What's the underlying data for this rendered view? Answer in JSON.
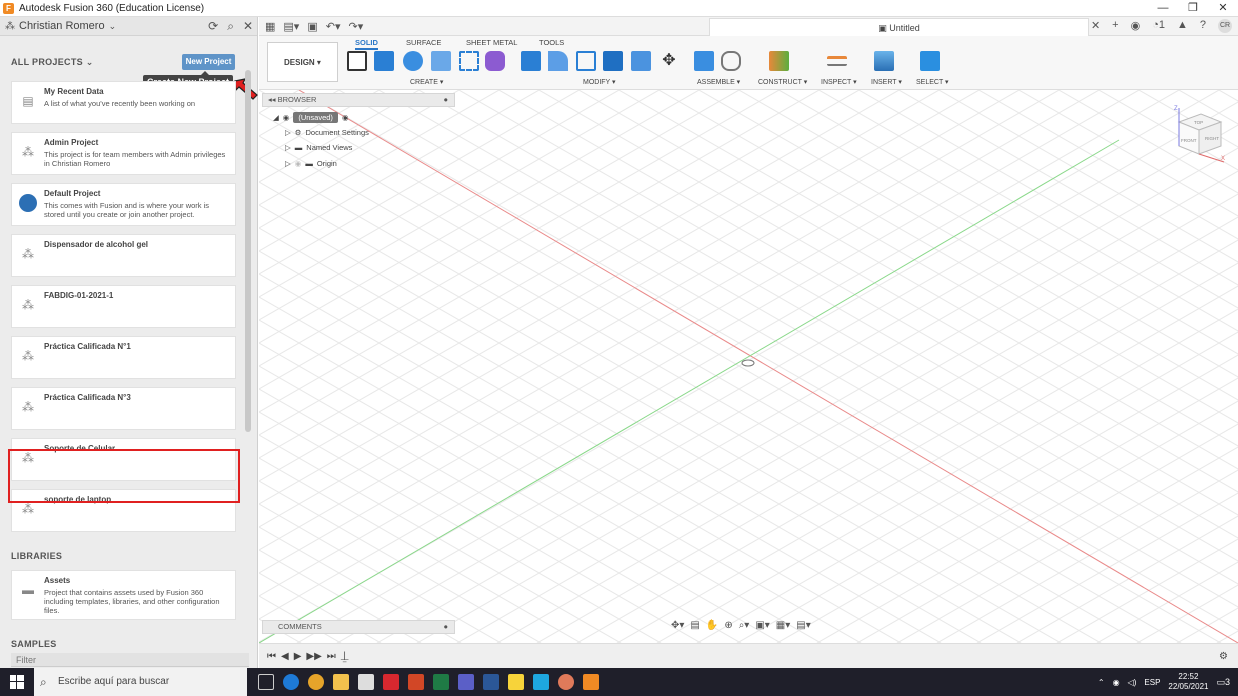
{
  "window": {
    "title": "Autodesk Fusion 360 (Education License)"
  },
  "data_panel": {
    "user_name": "Christian Romero",
    "all_projects_label": "ALL PROJECTS",
    "new_project_label": "New Project",
    "tooltip": "Create New Project",
    "projects": [
      {
        "name": "My Recent Data",
        "description": "A list of what you've recently been working on"
      },
      {
        "name": "Admin Project",
        "description": "This project is for team members with Admin privileges in Christian Romero"
      },
      {
        "name": "Default Project",
        "description": "This comes with Fusion and is where your work is stored until you create or join another project."
      },
      {
        "name": "Dispensador de alcohol gel",
        "description": ""
      },
      {
        "name": "FABDIG-01-2021-1",
        "description": ""
      },
      {
        "name": "Práctica Calificada N°1",
        "description": ""
      },
      {
        "name": "Práctica Calificada N°3",
        "description": ""
      },
      {
        "name": "Soporte de Celular",
        "description": ""
      },
      {
        "name": "soporte de laptop",
        "description": ""
      }
    ],
    "libraries_label": "LIBRARIES",
    "library": {
      "name": "Assets",
      "description": "Project that contains assets used by Fusion 360 including templates, libraries, and other configuration files."
    },
    "samples_label": "SAMPLES",
    "filter_placeholder": "Filter"
  },
  "document": {
    "tab_title": "Untitled",
    "user_initials": "CR",
    "job_count": "1"
  },
  "ribbon": {
    "workspace": "DESIGN ▾",
    "tabs": [
      "SOLID",
      "SURFACE",
      "SHEET METAL",
      "TOOLS"
    ],
    "groups": [
      "CREATE ▾",
      "MODIFY ▾",
      "ASSEMBLE ▾",
      "CONSTRUCT ▾",
      "INSPECT ▾",
      "INSERT ▾",
      "SELECT ▾"
    ]
  },
  "browser": {
    "title": "BROWSER",
    "root": "(Unsaved)",
    "nodes": [
      "Document Settings",
      "Named Views",
      "Origin"
    ]
  },
  "viewcube": {
    "top": "TOP",
    "front": "FRONT",
    "right": "RIGHT",
    "axis_x": "X",
    "axis_z": "Z"
  },
  "comments_label": "COMMENTS",
  "taskbar": {
    "search_placeholder": "Escribe aquí para buscar",
    "language": "ESP",
    "time": "22:52",
    "date": "22/05/2021",
    "notifications": "3"
  }
}
